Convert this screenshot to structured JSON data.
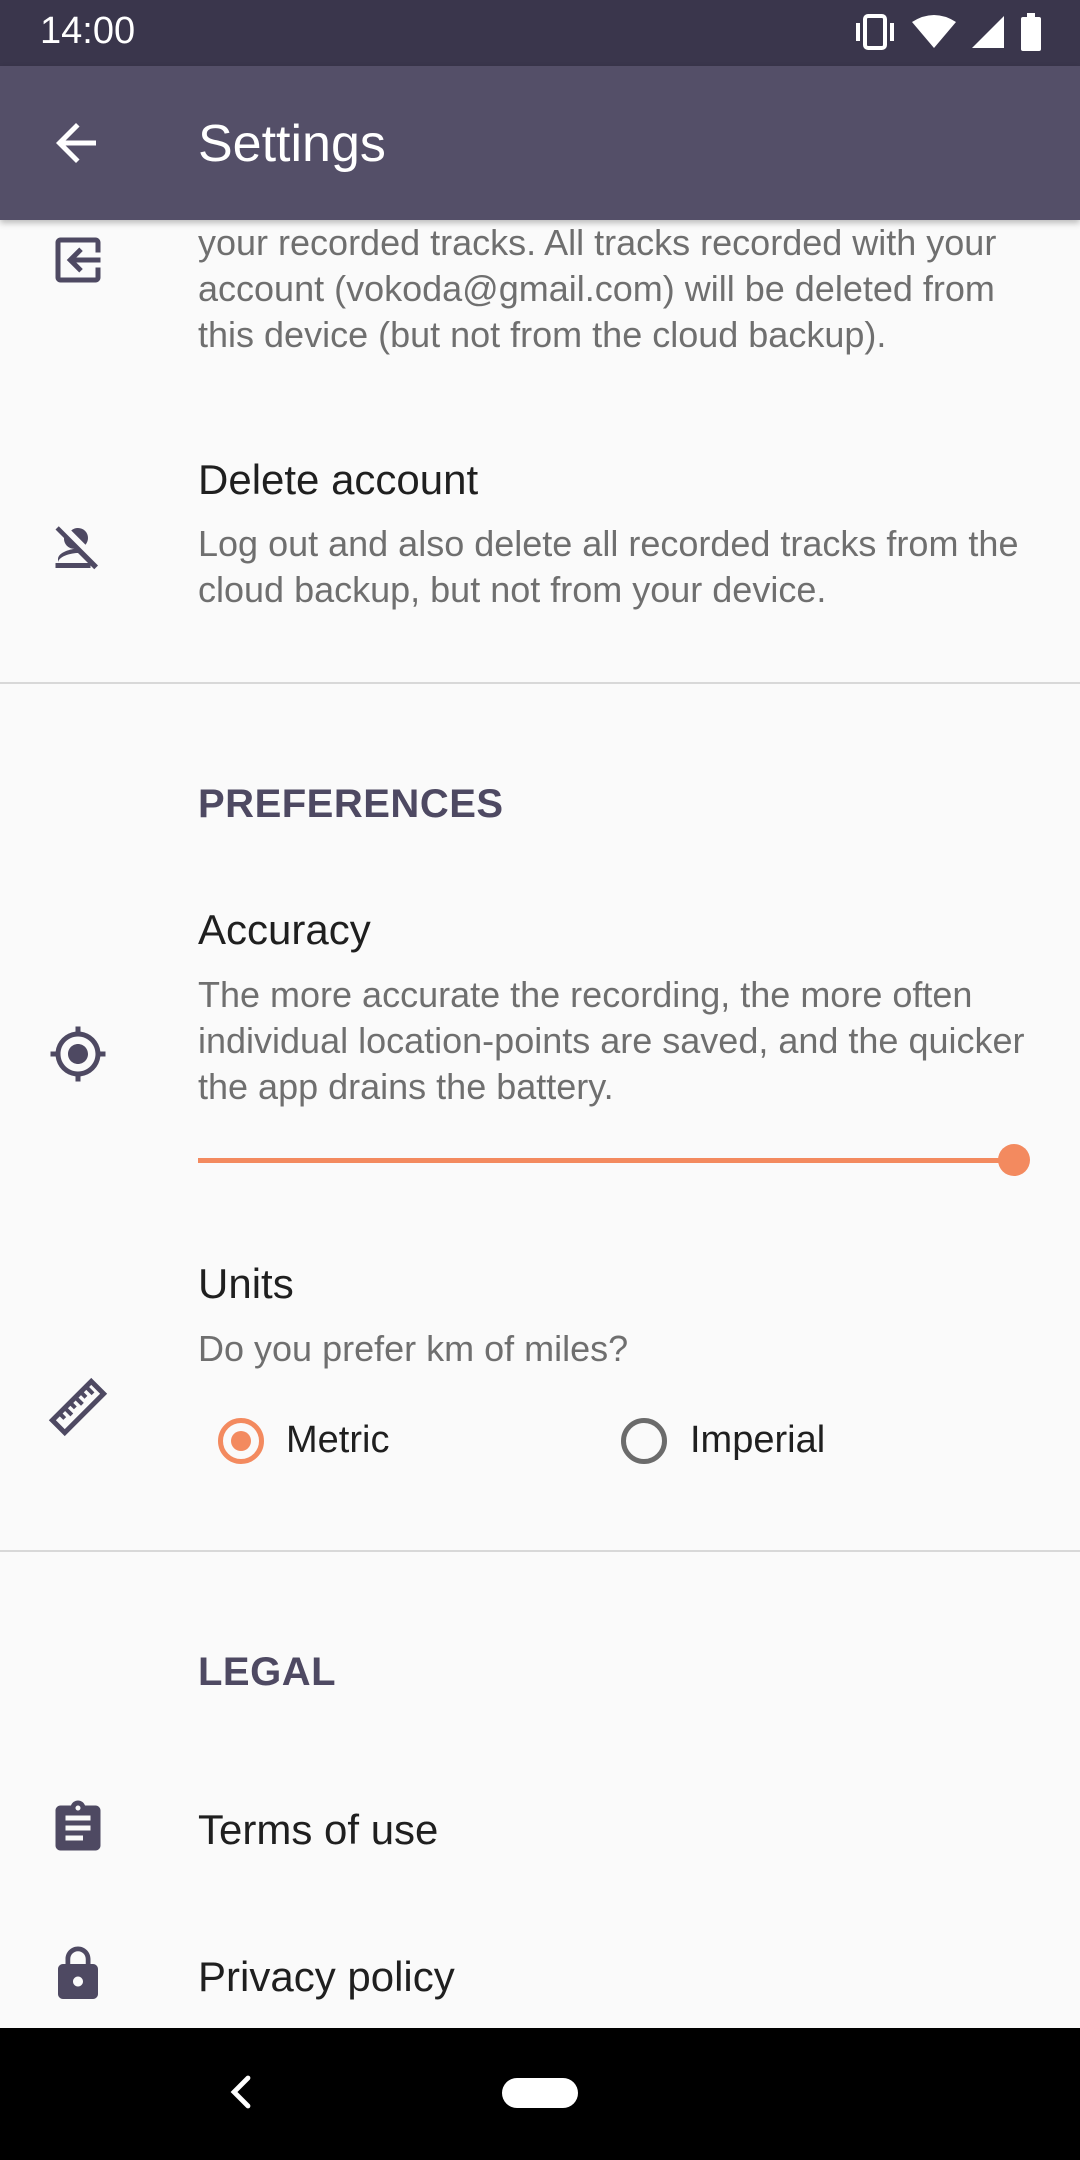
{
  "status": {
    "time": "14:00"
  },
  "app_bar": {
    "title": "Settings"
  },
  "logout": {
    "description": "your recorded tracks. All tracks recorded with your account (vokoda@gmail.com) will be deleted from this device (but not from the cloud backup)."
  },
  "delete_account": {
    "title": "Delete account",
    "description": "Log out and also delete all recorded tracks from the cloud backup, but not from your device."
  },
  "preferences": {
    "header": "PREFERENCES",
    "accuracy": {
      "title": "Accuracy",
      "description": "The more accurate the recording, the more often individual location-points are saved, and the quicker the app drains the battery.",
      "value_fraction": 1.0
    },
    "units": {
      "title": "Units",
      "description": "Do you prefer km of miles?",
      "options": [
        "Metric",
        "Imperial"
      ],
      "selected": "Metric"
    }
  },
  "legal": {
    "header": "LEGAL",
    "items": [
      "Terms of use",
      "Privacy policy"
    ]
  },
  "colors": {
    "status_bar": "#3a364c",
    "app_bar": "#544f68",
    "accent": "#f38a5f",
    "section_header": "#4e4962"
  },
  "icons": {
    "back": "arrow-left-icon",
    "logout": "logout-icon",
    "delete_account": "person-off-icon",
    "accuracy": "gps-target-icon",
    "units": "ruler-icon",
    "terms": "clipboard-icon",
    "privacy": "lock-icon"
  }
}
